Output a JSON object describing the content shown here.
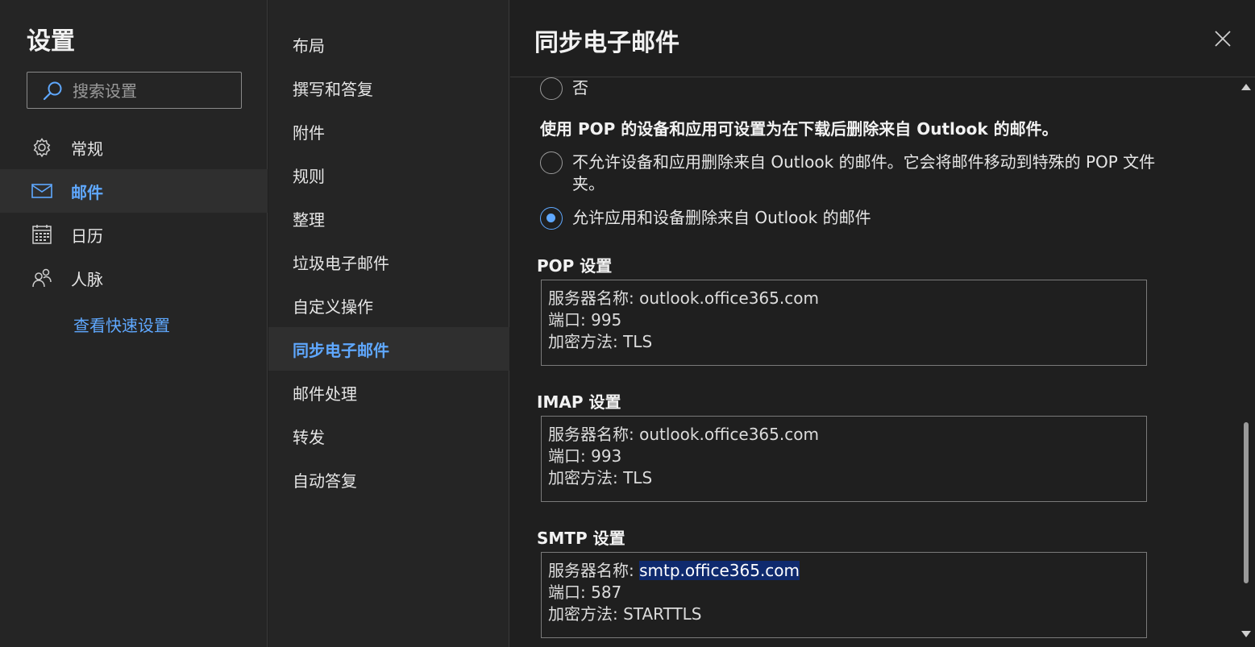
{
  "colors": {
    "accent": "#5fa8ff",
    "background": "#1f1f1f",
    "panel": "#252525",
    "highlight": "#0f2a6e"
  },
  "left": {
    "title": "设置",
    "search": {
      "placeholder": "搜索设置",
      "icon": "search-icon"
    },
    "categories": [
      {
        "label": "常规",
        "icon": "gear-icon",
        "active": false
      },
      {
        "label": "邮件",
        "icon": "mail-icon",
        "active": true
      },
      {
        "label": "日历",
        "icon": "calendar-icon",
        "active": false
      },
      {
        "label": "人脉",
        "icon": "people-icon",
        "active": false
      }
    ],
    "quick_settings_link": "查看快速设置"
  },
  "middle": {
    "items": [
      {
        "label": "布局"
      },
      {
        "label": "撰写和答复"
      },
      {
        "label": "附件"
      },
      {
        "label": "规则"
      },
      {
        "label": "整理"
      },
      {
        "label": "垃圾电子邮件"
      },
      {
        "label": "自定义操作"
      },
      {
        "label": "同步电子邮件",
        "active": true
      },
      {
        "label": "邮件处理"
      },
      {
        "label": "转发"
      },
      {
        "label": "自动答复"
      }
    ]
  },
  "main": {
    "title": "同步电子邮件",
    "close_icon": "close-icon",
    "option_no": "否",
    "pop_delete_question": "使用 POP 的设备和应用可设置为在下载后删除来自 Outlook 的邮件。",
    "pop_delete_options": [
      {
        "label": "不允许设备和应用删除来自 Outlook 的邮件。它会将邮件移动到特殊的 POP 文件夹。",
        "checked": false
      },
      {
        "label": "允许应用和设备删除来自 Outlook 的邮件",
        "checked": true
      }
    ],
    "pop": {
      "heading": "POP 设置",
      "server_label": "服务器名称: ",
      "server": "outlook.office365.com",
      "port": "端口: 995",
      "encryption": "加密方法: TLS"
    },
    "imap": {
      "heading": "IMAP 设置",
      "server_label": "服务器名称: ",
      "server": "outlook.office365.com",
      "port": "端口: 993",
      "encryption": "加密方法: TLS"
    },
    "smtp": {
      "heading": "SMTP 设置",
      "server_label": "服务器名称: ",
      "server": "smtp.office365.com",
      "port": "端口: 587",
      "encryption": "加密方法: STARTTLS"
    }
  }
}
